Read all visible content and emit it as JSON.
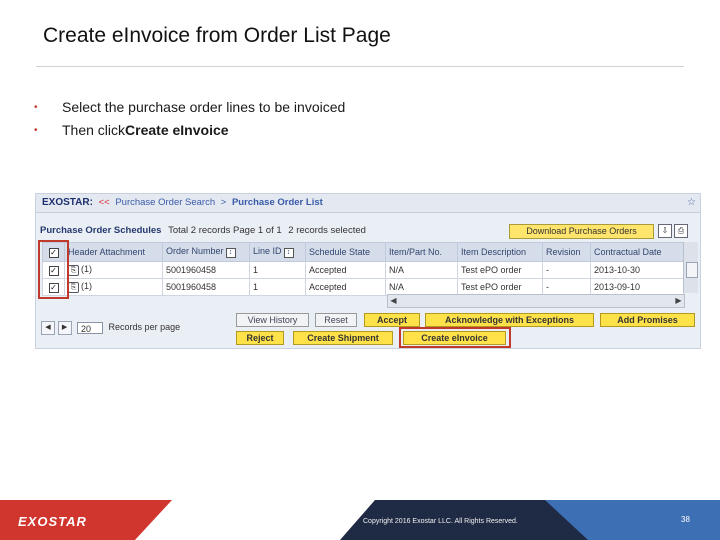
{
  "slide": {
    "title": "Create eInvoice from Order List Page",
    "bullets": [
      {
        "text": "Select the purchase order lines to be invoiced",
        "bold": ""
      },
      {
        "text": "Then click ",
        "bold": "Create eInvoice"
      }
    ],
    "page_number": "38",
    "copyright": "Copyright 2016 Exostar LLC. All Rights Reserved.",
    "footer_logo": "EXOSTAR"
  },
  "app": {
    "breadcrumb": {
      "logo": "EXOSTAR:",
      "arrows": "<<",
      "link": "Purchase Order Search",
      "separator": ">",
      "current": "Purchase Order List"
    },
    "schedules": {
      "title": "Purchase Order Schedules",
      "meta": "Total 2 records Page 1 of 1",
      "selected": "2 records selected",
      "download_button": "Download Purchase Orders"
    },
    "table": {
      "columns": [
        "",
        "Header Attachment",
        "Order Number",
        "Line ID",
        "Schedule State",
        "Item/Part No.",
        "Item Description",
        "Revision",
        "Contractual Date"
      ],
      "rows": [
        {
          "checked": "✓",
          "attachment": "(1)",
          "order_number": "5001960458",
          "line_id": "1",
          "state": "Accepted",
          "item": "N/A",
          "description": "Test ePO order",
          "revision": "-",
          "date": "2013-10-30"
        },
        {
          "checked": "✓",
          "attachment": "(1)",
          "order_number": "5001960458",
          "line_id": "1",
          "state": "Accepted",
          "item": "N/A",
          "description": "Test ePO order",
          "revision": "-",
          "date": "2013-09-10"
        }
      ]
    },
    "pager": {
      "page_size": "20",
      "label": "Records per page"
    },
    "buttons": {
      "view_history": "View History",
      "reset": "Reset",
      "accept": "Accept",
      "ack_exceptions": "Acknowledge with Exceptions",
      "add_promises": "Add Promises",
      "reject": "Reject",
      "create_shipment": "Create Shipment",
      "create_einvoice": "Create eInvoice"
    }
  },
  "colors": {
    "accent_red": "#c0392b",
    "footer_dark": "#1f2a44",
    "footer_red": "#d0352e",
    "button_yellow": "#ffe24a"
  }
}
